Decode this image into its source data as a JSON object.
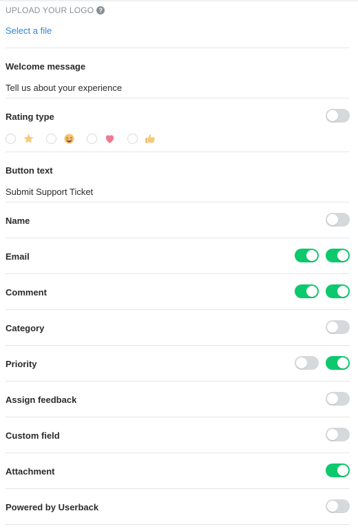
{
  "upload": {
    "label": "UPLOAD YOUR LOGO",
    "help_icon": "question-circle-icon",
    "link_text": "Select a file"
  },
  "welcome": {
    "title": "Welcome message",
    "value": "Tell us about your experience"
  },
  "rating": {
    "title": "Rating type",
    "enabled": false,
    "options": [
      {
        "icon": "star-icon",
        "selected": false
      },
      {
        "icon": "smiley-face-icon",
        "selected": false
      },
      {
        "icon": "heart-icon",
        "selected": false
      },
      {
        "icon": "thumbs-up-icon",
        "selected": false
      }
    ]
  },
  "button_text": {
    "title": "Button text",
    "value": "Submit Support Ticket"
  },
  "fields": [
    {
      "label": "Name",
      "toggles": [
        false
      ]
    },
    {
      "label": "Email",
      "toggles": [
        true,
        true
      ]
    },
    {
      "label": "Comment",
      "toggles": [
        true,
        true
      ]
    },
    {
      "label": "Category",
      "toggles": [
        false
      ]
    },
    {
      "label": "Priority",
      "toggles": [
        false,
        true
      ]
    },
    {
      "label": "Assign feedback",
      "toggles": [
        false
      ]
    },
    {
      "label": "Custom field",
      "toggles": [
        false
      ]
    },
    {
      "label": "Attachment",
      "toggles": [
        true
      ]
    },
    {
      "label": "Powered by Userback",
      "toggles": [
        false
      ]
    }
  ],
  "colors": {
    "toggle_on": "#0dc96d",
    "toggle_off": "#d6d9dc",
    "link": "#2e84d6"
  }
}
